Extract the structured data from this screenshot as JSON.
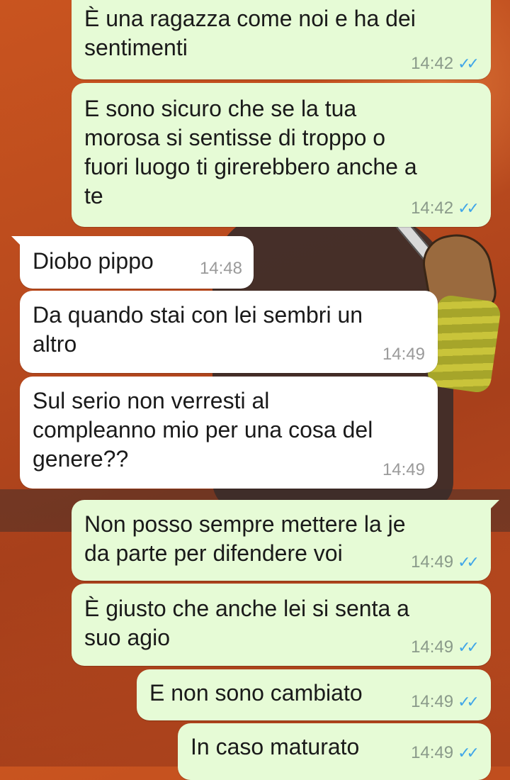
{
  "messages": [
    {
      "dir": "out",
      "text": "È una ragazza come noi e ha dei\nsentimenti",
      "time": "14:42",
      "ticks": "✓✓"
    },
    {
      "dir": "out",
      "text": "E sono sicuro che se la tua\nmorosa si sentisse di troppo o\nfuori luogo ti girerebbero anche a\nte",
      "time": "14:42",
      "ticks": "✓✓"
    },
    {
      "dir": "in",
      "text": "Diobo pippo",
      "time": "14:48"
    },
    {
      "dir": "in",
      "text": "Da quando stai con lei sembri un\naltro",
      "time": "14:49"
    },
    {
      "dir": "in",
      "text": "Sul serio non verresti al\ncompleanno mio per una cosa del\ngenere??",
      "time": "14:49"
    },
    {
      "dir": "out",
      "text": "Non posso sempre mettere la je\nda parte per difendere voi",
      "time": "14:49",
      "ticks": "✓✓"
    },
    {
      "dir": "out",
      "text": "È giusto che anche lei si senta a\nsuo agio",
      "time": "14:49",
      "ticks": "✓✓"
    },
    {
      "dir": "out",
      "text": "E non sono cambiato",
      "time": "14:49",
      "ticks": "✓✓"
    },
    {
      "dir": "out",
      "text": "In caso maturato",
      "time": "14:49",
      "ticks": "✓✓"
    }
  ],
  "colors": {
    "outgoing_bubble": "#e6fbd6",
    "incoming_bubble": "#ffffff",
    "read_ticks": "#41a6e8"
  },
  "icons": {
    "read_receipt": "double-check-icon"
  }
}
